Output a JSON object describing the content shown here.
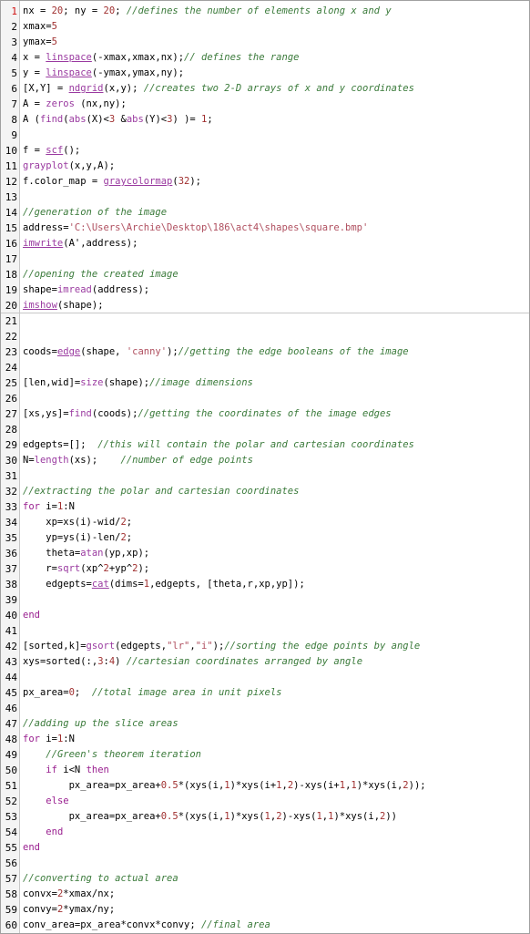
{
  "colors": {
    "comment": "#3a7a3a",
    "function": "#9a3aa0",
    "number": "#a03030",
    "string": "#b05060",
    "keyword": "#9a2090",
    "active_line_number": "#d01010"
  },
  "editor": {
    "active_line": 1,
    "lines": [
      {
        "n": "1",
        "tokens": [
          {
            "t": "nx = ",
            "c": "plain"
          },
          {
            "t": "20",
            "c": "num"
          },
          {
            "t": "; ny = ",
            "c": "plain"
          },
          {
            "t": "20",
            "c": "num"
          },
          {
            "t": "; ",
            "c": "plain"
          },
          {
            "t": "//defines the number of elements along x and y",
            "c": "cmt"
          }
        ]
      },
      {
        "n": "2",
        "tokens": [
          {
            "t": "xmax=",
            "c": "plain"
          },
          {
            "t": "5",
            "c": "num"
          }
        ]
      },
      {
        "n": "3",
        "tokens": [
          {
            "t": "ymax=",
            "c": "plain"
          },
          {
            "t": "5",
            "c": "num"
          }
        ]
      },
      {
        "n": "4",
        "tokens": [
          {
            "t": "x = ",
            "c": "plain"
          },
          {
            "t": "linspace",
            "c": "lnk"
          },
          {
            "t": "(-xmax,xmax,nx);",
            "c": "plain"
          },
          {
            "t": "// defines the range",
            "c": "cmt"
          }
        ]
      },
      {
        "n": "5",
        "tokens": [
          {
            "t": "y = ",
            "c": "plain"
          },
          {
            "t": "linspace",
            "c": "lnk"
          },
          {
            "t": "(-ymax,ymax,ny);",
            "c": "plain"
          }
        ]
      },
      {
        "n": "6",
        "tokens": [
          {
            "t": "[X,Y] = ",
            "c": "plain"
          },
          {
            "t": "ndgrid",
            "c": "lnk"
          },
          {
            "t": "(x,y); ",
            "c": "plain"
          },
          {
            "t": "//creates two 2-D arrays of x and y coordinates",
            "c": "cmt"
          }
        ]
      },
      {
        "n": "7",
        "tokens": [
          {
            "t": "A = ",
            "c": "plain"
          },
          {
            "t": "zeros",
            "c": "fn"
          },
          {
            "t": " (nx,ny);",
            "c": "plain"
          }
        ]
      },
      {
        "n": "8",
        "tokens": [
          {
            "t": "A (",
            "c": "plain"
          },
          {
            "t": "find",
            "c": "fn"
          },
          {
            "t": "(",
            "c": "plain"
          },
          {
            "t": "abs",
            "c": "fn"
          },
          {
            "t": "(X)<",
            "c": "plain"
          },
          {
            "t": "3",
            "c": "num"
          },
          {
            "t": " &",
            "c": "plain"
          },
          {
            "t": "abs",
            "c": "fn"
          },
          {
            "t": "(Y)<",
            "c": "plain"
          },
          {
            "t": "3",
            "c": "num"
          },
          {
            "t": ") )= ",
            "c": "plain"
          },
          {
            "t": "1",
            "c": "num"
          },
          {
            "t": ";",
            "c": "plain"
          }
        ]
      },
      {
        "n": "9",
        "tokens": []
      },
      {
        "n": "10",
        "tokens": [
          {
            "t": "f = ",
            "c": "plain"
          },
          {
            "t": "scf",
            "c": "lnk"
          },
          {
            "t": "();",
            "c": "plain"
          }
        ]
      },
      {
        "n": "11",
        "tokens": [
          {
            "t": "grayplot",
            "c": "fn"
          },
          {
            "t": "(x,y,A);",
            "c": "plain"
          }
        ]
      },
      {
        "n": "12",
        "tokens": [
          {
            "t": "f.color_map",
            "c": "plain"
          },
          {
            "t": " = ",
            "c": "plain"
          },
          {
            "t": "graycolormap",
            "c": "lnk"
          },
          {
            "t": "(",
            "c": "plain"
          },
          {
            "t": "32",
            "c": "num"
          },
          {
            "t": ");",
            "c": "plain"
          }
        ]
      },
      {
        "n": "13",
        "tokens": []
      },
      {
        "n": "14",
        "tokens": [
          {
            "t": "//generation of the image",
            "c": "cmt"
          }
        ]
      },
      {
        "n": "15",
        "tokens": [
          {
            "t": "address=",
            "c": "plain"
          },
          {
            "t": "'C:\\Users\\Archie\\Desktop\\186\\act4\\shapes\\square.bmp'",
            "c": "str"
          }
        ]
      },
      {
        "n": "16",
        "tokens": [
          {
            "t": "imwrite",
            "c": "lnk"
          },
          {
            "t": "(A',address);",
            "c": "plain"
          }
        ]
      },
      {
        "n": "17",
        "tokens": []
      },
      {
        "n": "18",
        "tokens": [
          {
            "t": "//opening the created image",
            "c": "cmt"
          }
        ]
      },
      {
        "n": "19",
        "tokens": [
          {
            "t": "shape=",
            "c": "plain"
          },
          {
            "t": "imread",
            "c": "fn"
          },
          {
            "t": "(address);",
            "c": "plain"
          }
        ]
      },
      {
        "n": "20",
        "sep": true,
        "tokens": [
          {
            "t": "imshow",
            "c": "lnk"
          },
          {
            "t": "(shape);",
            "c": "plain"
          }
        ]
      },
      {
        "n": "21",
        "tokens": []
      },
      {
        "n": "22",
        "tokens": []
      },
      {
        "n": "23",
        "tokens": [
          {
            "t": "coods=",
            "c": "plain"
          },
          {
            "t": "edge",
            "c": "lnk"
          },
          {
            "t": "(shape, ",
            "c": "plain"
          },
          {
            "t": "'canny'",
            "c": "str"
          },
          {
            "t": ");",
            "c": "plain"
          },
          {
            "t": "//getting the edge booleans of the image",
            "c": "cmt"
          }
        ]
      },
      {
        "n": "24",
        "tokens": []
      },
      {
        "n": "25",
        "tokens": [
          {
            "t": "[len,wid]=",
            "c": "plain"
          },
          {
            "t": "size",
            "c": "fn"
          },
          {
            "t": "(shape);",
            "c": "plain"
          },
          {
            "t": "//image dimensions",
            "c": "cmt"
          }
        ]
      },
      {
        "n": "26",
        "tokens": []
      },
      {
        "n": "27",
        "tokens": [
          {
            "t": "[xs,ys]=",
            "c": "plain"
          },
          {
            "t": "find",
            "c": "fn"
          },
          {
            "t": "(coods);",
            "c": "plain"
          },
          {
            "t": "//getting the coordinates of the image edges",
            "c": "cmt"
          }
        ]
      },
      {
        "n": "28",
        "tokens": []
      },
      {
        "n": "29",
        "tokens": [
          {
            "t": "edgepts=[];  ",
            "c": "plain"
          },
          {
            "t": "//this will contain the polar and cartesian coordinates",
            "c": "cmt"
          }
        ]
      },
      {
        "n": "30",
        "tokens": [
          {
            "t": "N=",
            "c": "plain"
          },
          {
            "t": "length",
            "c": "fn"
          },
          {
            "t": "(xs);    ",
            "c": "plain"
          },
          {
            "t": "//number of edge points",
            "c": "cmt"
          }
        ]
      },
      {
        "n": "31",
        "tokens": []
      },
      {
        "n": "32",
        "tokens": [
          {
            "t": "//extracting the polar and cartesian coordinates",
            "c": "cmt"
          }
        ]
      },
      {
        "n": "33",
        "tokens": [
          {
            "t": "for",
            "c": "kw"
          },
          {
            "t": " i=",
            "c": "plain"
          },
          {
            "t": "1",
            "c": "num"
          },
          {
            "t": ":N",
            "c": "plain"
          }
        ]
      },
      {
        "n": "34",
        "tokens": [
          {
            "t": "    xp=xs(i)-wid/",
            "c": "plain"
          },
          {
            "t": "2",
            "c": "num"
          },
          {
            "t": ";",
            "c": "plain"
          }
        ]
      },
      {
        "n": "35",
        "tokens": [
          {
            "t": "    yp=ys(i)-len/",
            "c": "plain"
          },
          {
            "t": "2",
            "c": "num"
          },
          {
            "t": ";",
            "c": "plain"
          }
        ]
      },
      {
        "n": "36",
        "tokens": [
          {
            "t": "    theta=",
            "c": "plain"
          },
          {
            "t": "atan",
            "c": "fn"
          },
          {
            "t": "(yp,xp);",
            "c": "plain"
          }
        ]
      },
      {
        "n": "37",
        "tokens": [
          {
            "t": "    r=",
            "c": "plain"
          },
          {
            "t": "sqrt",
            "c": "fn"
          },
          {
            "t": "(xp^",
            "c": "plain"
          },
          {
            "t": "2",
            "c": "num"
          },
          {
            "t": "+yp^",
            "c": "plain"
          },
          {
            "t": "2",
            "c": "num"
          },
          {
            "t": ");",
            "c": "plain"
          }
        ]
      },
      {
        "n": "38",
        "tokens": [
          {
            "t": "    edgepts=",
            "c": "plain"
          },
          {
            "t": "cat",
            "c": "lnk"
          },
          {
            "t": "(dims=",
            "c": "plain"
          },
          {
            "t": "1",
            "c": "num"
          },
          {
            "t": ",edgepts, [theta,r,xp,yp]);",
            "c": "plain"
          }
        ]
      },
      {
        "n": "39",
        "tokens": []
      },
      {
        "n": "40",
        "tokens": [
          {
            "t": "end",
            "c": "kw"
          }
        ]
      },
      {
        "n": "41",
        "tokens": []
      },
      {
        "n": "42",
        "tokens": [
          {
            "t": "[sorted,k]=",
            "c": "plain"
          },
          {
            "t": "gsort",
            "c": "fn"
          },
          {
            "t": "(edgepts,",
            "c": "plain"
          },
          {
            "t": "\"lr\"",
            "c": "str"
          },
          {
            "t": ",",
            "c": "plain"
          },
          {
            "t": "\"i\"",
            "c": "str"
          },
          {
            "t": ");",
            "c": "plain"
          },
          {
            "t": "//sorting the edge points by angle",
            "c": "cmt"
          }
        ]
      },
      {
        "n": "43",
        "tokens": [
          {
            "t": "xys=sorted(:,",
            "c": "plain"
          },
          {
            "t": "3",
            "c": "num"
          },
          {
            "t": ":",
            "c": "plain"
          },
          {
            "t": "4",
            "c": "num"
          },
          {
            "t": ") ",
            "c": "plain"
          },
          {
            "t": "//cartesian coordinates arranged by angle",
            "c": "cmt"
          }
        ]
      },
      {
        "n": "44",
        "tokens": []
      },
      {
        "n": "45",
        "tokens": [
          {
            "t": "px_area=",
            "c": "plain"
          },
          {
            "t": "0",
            "c": "num"
          },
          {
            "t": ";  ",
            "c": "plain"
          },
          {
            "t": "//total image area in unit pixels",
            "c": "cmt"
          }
        ]
      },
      {
        "n": "46",
        "tokens": []
      },
      {
        "n": "47",
        "tokens": [
          {
            "t": "//adding up the slice areas",
            "c": "cmt"
          }
        ]
      },
      {
        "n": "48",
        "tokens": [
          {
            "t": "for",
            "c": "kw"
          },
          {
            "t": " i=",
            "c": "plain"
          },
          {
            "t": "1",
            "c": "num"
          },
          {
            "t": ":N",
            "c": "plain"
          }
        ]
      },
      {
        "n": "49",
        "tokens": [
          {
            "t": "    ",
            "c": "plain"
          },
          {
            "t": "//Green's theorem iteration",
            "c": "cmt"
          }
        ]
      },
      {
        "n": "50",
        "tokens": [
          {
            "t": "    ",
            "c": "plain"
          },
          {
            "t": "if",
            "c": "kw"
          },
          {
            "t": " i<N ",
            "c": "plain"
          },
          {
            "t": "then",
            "c": "kw"
          }
        ]
      },
      {
        "n": "51",
        "tokens": [
          {
            "t": "        px_area=px_area+",
            "c": "plain"
          },
          {
            "t": "0.5",
            "c": "num"
          },
          {
            "t": "*(xys(i,",
            "c": "plain"
          },
          {
            "t": "1",
            "c": "num"
          },
          {
            "t": ")*xys(i+",
            "c": "plain"
          },
          {
            "t": "1",
            "c": "num"
          },
          {
            "t": ",",
            "c": "plain"
          },
          {
            "t": "2",
            "c": "num"
          },
          {
            "t": ")-xys(i+",
            "c": "plain"
          },
          {
            "t": "1",
            "c": "num"
          },
          {
            "t": ",",
            "c": "plain"
          },
          {
            "t": "1",
            "c": "num"
          },
          {
            "t": ")*xys(i,",
            "c": "plain"
          },
          {
            "t": "2",
            "c": "num"
          },
          {
            "t": "));",
            "c": "plain"
          }
        ]
      },
      {
        "n": "52",
        "tokens": [
          {
            "t": "    ",
            "c": "plain"
          },
          {
            "t": "else",
            "c": "kw"
          }
        ]
      },
      {
        "n": "53",
        "tokens": [
          {
            "t": "        px_area=px_area+",
            "c": "plain"
          },
          {
            "t": "0.5",
            "c": "num"
          },
          {
            "t": "*(xys(i,",
            "c": "plain"
          },
          {
            "t": "1",
            "c": "num"
          },
          {
            "t": ")*xys(",
            "c": "plain"
          },
          {
            "t": "1",
            "c": "num"
          },
          {
            "t": ",",
            "c": "plain"
          },
          {
            "t": "2",
            "c": "num"
          },
          {
            "t": ")-xys(",
            "c": "plain"
          },
          {
            "t": "1",
            "c": "num"
          },
          {
            "t": ",",
            "c": "plain"
          },
          {
            "t": "1",
            "c": "num"
          },
          {
            "t": ")*xys(i,",
            "c": "plain"
          },
          {
            "t": "2",
            "c": "num"
          },
          {
            "t": "))",
            "c": "plain"
          }
        ]
      },
      {
        "n": "54",
        "tokens": [
          {
            "t": "    ",
            "c": "plain"
          },
          {
            "t": "end",
            "c": "kw"
          }
        ]
      },
      {
        "n": "55",
        "tokens": [
          {
            "t": "end",
            "c": "kw"
          }
        ]
      },
      {
        "n": "56",
        "tokens": []
      },
      {
        "n": "57",
        "tokens": [
          {
            "t": "//converting to actual area",
            "c": "cmt"
          }
        ]
      },
      {
        "n": "58",
        "tokens": [
          {
            "t": "convx=",
            "c": "plain"
          },
          {
            "t": "2",
            "c": "num"
          },
          {
            "t": "*xmax/nx;",
            "c": "plain"
          }
        ]
      },
      {
        "n": "59",
        "tokens": [
          {
            "t": "convy=",
            "c": "plain"
          },
          {
            "t": "2",
            "c": "num"
          },
          {
            "t": "*ymax/ny;",
            "c": "plain"
          }
        ]
      },
      {
        "n": "60",
        "tokens": [
          {
            "t": "conv_area=px_area*convx*convy; ",
            "c": "plain"
          },
          {
            "t": "//final area",
            "c": "cmt"
          }
        ]
      }
    ]
  }
}
